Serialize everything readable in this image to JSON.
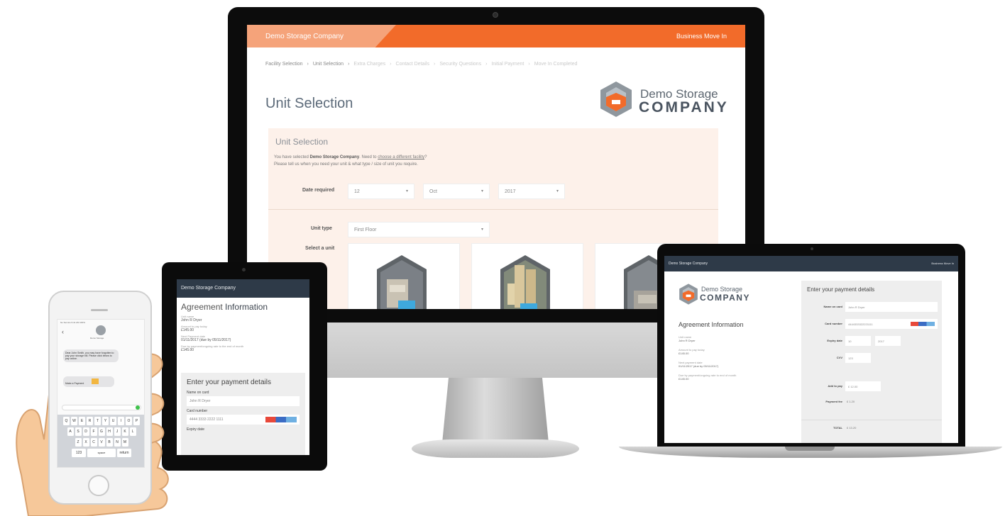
{
  "desktop": {
    "brand": "Demo Storage Company",
    "business": "Business Move In",
    "breadcrumbs": [
      {
        "label": "Facility Selection",
        "active": true
      },
      {
        "label": "Unit Selection",
        "active": true
      },
      {
        "label": "Extra Charges",
        "active": false
      },
      {
        "label": "Contact Details",
        "active": false
      },
      {
        "label": "Security Questions",
        "active": false
      },
      {
        "label": "Initial Payment",
        "active": false
      },
      {
        "label": "Move In Completed",
        "active": false
      }
    ],
    "page_title": "Unit Selection",
    "logo_line1": "Demo Storage",
    "logo_line2": "COMPANY",
    "panel_title": "Unit Selection",
    "intro_prefix": "You have selected ",
    "intro_facility": "Demo Storage Company",
    "intro_mid": ". Need to ",
    "intro_link": "choose a different facility",
    "intro_suffix": "?",
    "intro_line2": "Please tell us when you need your unit & what type / size of unit you require.",
    "date_label": "Date required",
    "date_day": "12",
    "date_month": "Oct",
    "date_year": "2017",
    "unit_type_label": "Unit type",
    "unit_type_value": "First Floor",
    "select_unit_label": "Select a unit"
  },
  "tablet": {
    "brand": "Demo Storage Company",
    "heading_light": "Agreement",
    "heading_bold": "Information",
    "rows": [
      {
        "key": "Unit name",
        "value": "John R Dryer"
      },
      {
        "key": "Amount to pay today",
        "value": "£145.00"
      },
      {
        "key": "Next Payment date",
        "value": "01/11/2017 (due by 05/11/2017)"
      },
      {
        "key": "Due by payment/ongoing rate to the end of month",
        "value": "£145.00"
      }
    ],
    "payment_title": "Enter your payment details",
    "name_label": "Name on card",
    "name_value": "John R Dryer",
    "card_label": "Card number",
    "card_value": "4444 3333 2222 1111",
    "expiry_label": "Expiry date"
  },
  "laptop": {
    "brand": "Demo Storage Company",
    "business": "Business Move In",
    "logo_line1": "Demo Storage",
    "logo_line2": "COMPANY",
    "agreement_heading": "Agreement Information",
    "rows": [
      {
        "key": "Unit name",
        "value": "John R Dryer"
      },
      {
        "key": "Amount to pay today",
        "value": "£145.00"
      },
      {
        "key": "Next payment date",
        "value": "01/11/2017 (due by 05/11/2017)"
      },
      {
        "key": "Due by payment/ongoing rate to end of month",
        "value": "£145.00"
      }
    ],
    "payment_title": "Enter your payment details",
    "name_label": "Name on card",
    "name_value": "John R Dryer",
    "card_label": "Card number",
    "card_value": "4444333322221111",
    "expiry_label": "Expiry date",
    "expiry_month": "10",
    "expiry_year": "2017",
    "cvv_label": "CVV",
    "cvv_value": "123",
    "add_to_pay_label": "Add to pay",
    "add_to_pay_value": "£ 12.00",
    "payment_fee_label": "Payment fee",
    "payment_fee_value": "£ 1.20",
    "total_label": "TOTAL",
    "total_value": "£ 13.20"
  },
  "phone": {
    "status": "No Service  9:41 AM  100%",
    "contact": "Demo Storage",
    "message1": "Dear John Smith, you may have forgotten to pay your storage bill. Please click below to pay online.",
    "message2": "Make a Payment",
    "keyboard_rows": [
      [
        "Q",
        "W",
        "E",
        "R",
        "T",
        "Y",
        "U",
        "I",
        "O",
        "P"
      ],
      [
        "A",
        "S",
        "D",
        "F",
        "G",
        "H",
        "J",
        "K",
        "L"
      ],
      [
        "Z",
        "X",
        "C",
        "V",
        "B",
        "N",
        "M"
      ]
    ],
    "space_label": "space",
    "return_label": "return",
    "num_label": "123"
  },
  "colors": {
    "brand_orange": "#f26b2a",
    "navy": "#2e3a48",
    "panel_bg": "#fdf1ea"
  }
}
